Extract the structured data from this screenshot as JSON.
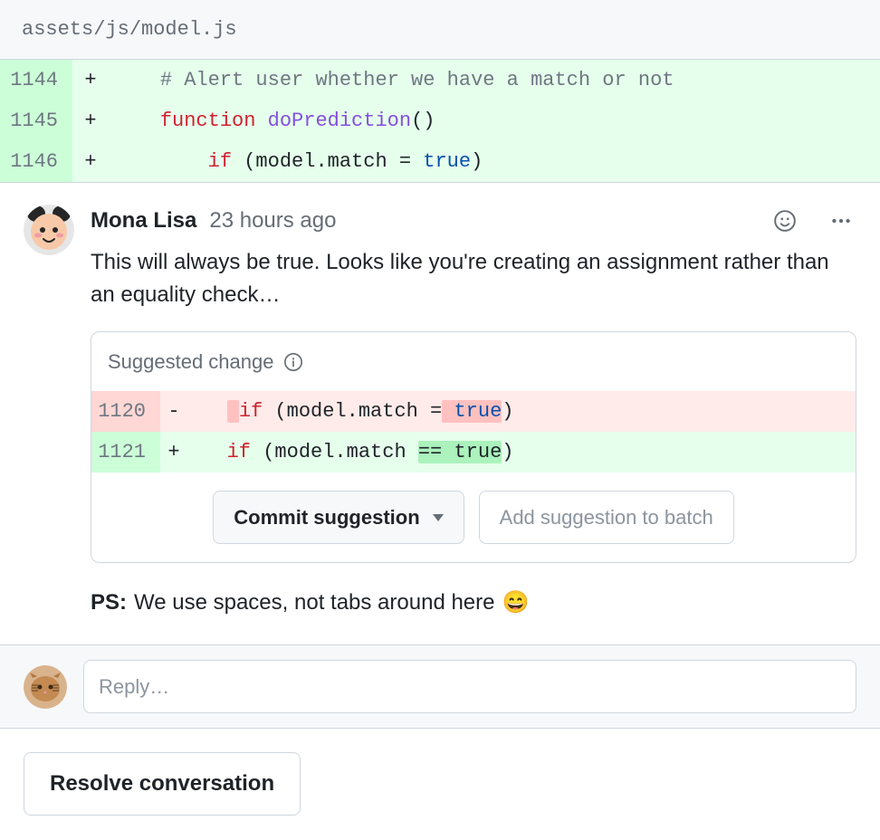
{
  "file": {
    "path": "assets/js/model.js"
  },
  "diff": [
    {
      "num": "1144",
      "mark": "+",
      "tokens": [
        {
          "t": "    ",
          "c": ""
        },
        {
          "t": "# Alert user whether we have a match or not",
          "c": "t-comment"
        }
      ]
    },
    {
      "num": "1145",
      "mark": "+",
      "tokens": [
        {
          "t": "    ",
          "c": ""
        },
        {
          "t": "function",
          "c": "t-keyword"
        },
        {
          "t": " ",
          "c": ""
        },
        {
          "t": "doPrediction",
          "c": "t-fn"
        },
        {
          "t": "()",
          "c": ""
        }
      ]
    },
    {
      "num": "1146",
      "mark": "+",
      "tokens": [
        {
          "t": "        ",
          "c": ""
        },
        {
          "t": "if",
          "c": "t-keyword"
        },
        {
          "t": " (model.match = ",
          "c": ""
        },
        {
          "t": "true",
          "c": "t-const"
        },
        {
          "t": ")",
          "c": ""
        }
      ]
    }
  ],
  "comment": {
    "author": "Mona Lisa",
    "time": "23 hours ago",
    "body": "This will always be true. Looks like you're creating an assignment rather than an equality check…"
  },
  "suggestion": {
    "label": "Suggested change",
    "del_num": "1120",
    "add_num": "1121",
    "del": [
      {
        "t": "   ",
        "c": ""
      },
      {
        "t": " ",
        "c": "hl-del"
      },
      {
        "t": "if",
        "c": "t-keyword"
      },
      {
        "t": " (model.match =",
        "c": ""
      },
      {
        "t": " true",
        "c": "hl-del t-const"
      },
      {
        "t": ")",
        "c": ""
      }
    ],
    "add": [
      {
        "t": "   ",
        "c": ""
      },
      {
        "t": "if",
        "c": "t-keyword"
      },
      {
        "t": " (model.match ",
        "c": ""
      },
      {
        "t": "== true",
        "c": "hl-add"
      },
      {
        "t": ")",
        "c": ""
      }
    ],
    "commit_label": "Commit suggestion",
    "batch_label": "Add suggestion to batch"
  },
  "ps": {
    "label": "PS:",
    "text": " We use spaces, not tabs around here ",
    "emoji": "😄"
  },
  "reply": {
    "placeholder": "Reply…"
  },
  "resolve": {
    "label": "Resolve conversation"
  }
}
